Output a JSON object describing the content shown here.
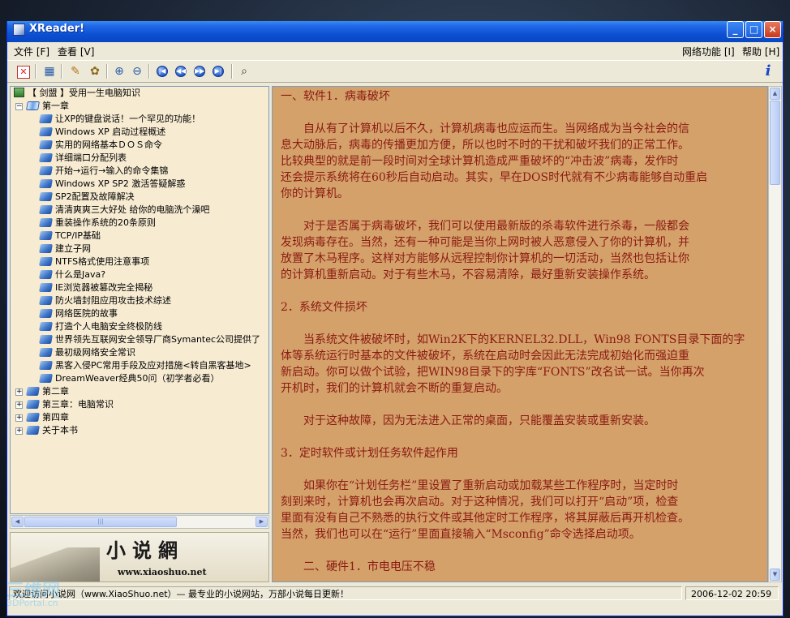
{
  "window": {
    "title": "XReader!"
  },
  "menu": {
    "file": "文件 [F]",
    "view": "查看 [V]",
    "network": "网络功能 [I]",
    "help": "帮助 [H]"
  },
  "tree": {
    "root": "【 剑盟 】受用一生电脑知识",
    "chapter1": "第一章",
    "items": [
      "让XP的键盘说话！一个罕见的功能！",
      "Windows XP 启动过程概述",
      "实用的网络基本ＤＯＳ命令",
      "详细端口分配列表",
      "开始→运行→输入的命令集锦",
      "Windows XP SP2 激活答疑解惑",
      "SP2配置及故障解决",
      "清清爽爽三大好处 给你的电脑洗个澡吧",
      "重装操作系统的20条原则",
      "TCP/IP基础",
      "建立子网",
      "NTFS格式使用注意事项",
      "什么是Java?",
      "IE浏览器被篡改完全揭秘",
      "防火墙封阻应用攻击技术综述",
      "网络医院的故事",
      "打造个人电脑安全终极防线",
      "世界领先互联网安全领导厂商Symantec公司提供了",
      "最初级网络安全常识",
      "黑客入侵PC常用手段及应对措施<转自黑客基地>",
      "DreamWeaver经典50问（初学者必看）"
    ],
    "other_chapters": [
      "第二章",
      "第三章：电脑常识",
      "第四章",
      "关于本书"
    ]
  },
  "banner": {
    "title": "小说網",
    "url": "www.xiaoshuo.net"
  },
  "content": {
    "lines": [
      "一、软件1．病毒破坏",
      "",
      "　　自从有了计算机以后不久，计算机病毒也应运而生。当网络成为当今社会的信",
      "息大动脉后，病毒的传播更加方便，所以也时不时的干扰和破坏我们的正常工作。",
      "比较典型的就是前一段时间对全球计算机造成严重破坏的“冲击波”病毒，发作时",
      "还会提示系统将在60秒后自动启动。其实，早在DOS时代就有不少病毒能够自动重启",
      "你的计算机。",
      "",
      "　　对于是否属于病毒破坏，我们可以使用最新版的杀毒软件进行杀毒，一般都会",
      "发现病毒存在。当然，还有一种可能是当你上网时被人恶意侵入了你的计算机，并",
      "放置了木马程序。这样对方能够从远程控制你计算机的一切活动，当然也包括让你",
      "的计算机重新启动。对于有些木马，不容易清除，最好重新安装操作系统。",
      "",
      "2．系统文件损坏",
      "",
      "　　当系统文件被破坏时，如Win2K下的KERNEL32.DLL，Win98 FONTS目录下面的字",
      "体等系统运行时基本的文件被破坏，系统在启动时会因此无法完成初始化而强迫重",
      "新启动。你可以做个试验，把WIN98目录下的字库“FONTS”改名试一试。当你再次",
      "开机时，我们的计算机就会不断的重复启动。",
      "",
      "　　对于这种故障，因为无法进入正常的桌面，只能覆盖安装或重新安装。",
      "",
      "3．定时软件或计划任务软件起作用",
      "",
      "　　如果你在“计划任务栏”里设置了重新启动或加载某些工作程序时，当定时时",
      "刻到来时，计算机也会再次启动。对于这种情况，我们可以打开“启动”项，检查",
      "里面有没有自己不熟悉的执行文件或其他定时工作程序，将其屏蔽后再开机检查。",
      "当然，我们也可以在“运行”里面直接输入“Msconfig”命令选择启动项。",
      "",
      "　　二、硬件1．市电电压不稳"
    ]
  },
  "status": {
    "message": "欢迎访问小说网（www.XiaoShuo.net）— 最专业的小说网站，万部小说每日更新！",
    "datetime": "2006-12-02 20:59"
  },
  "watermark": {
    "text": "三维网",
    "sub": "3DPortal.cn"
  },
  "colors": {
    "content_bg": "#d4a16b",
    "content_text": "#8b1a10",
    "tree_bg": "#f7ebd2",
    "titlebar": "#0b4fd0"
  }
}
